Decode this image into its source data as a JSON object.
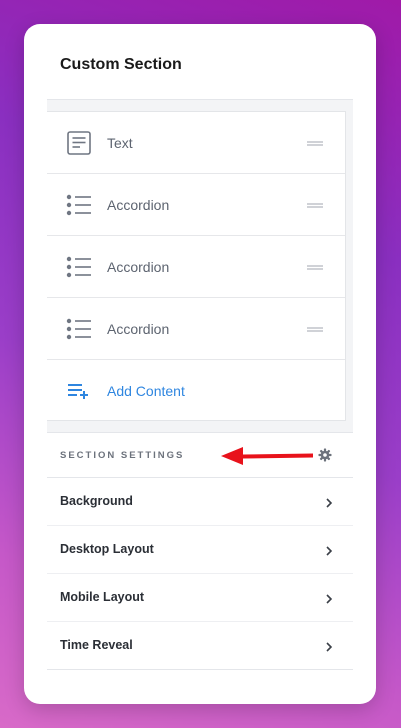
{
  "panel": {
    "title": "Custom Section"
  },
  "content_items": [
    {
      "icon": "text-icon",
      "label": "Text"
    },
    {
      "icon": "list-icon",
      "label": "Accordion"
    },
    {
      "icon": "list-icon",
      "label": "Accordion"
    },
    {
      "icon": "list-icon",
      "label": "Accordion"
    }
  ],
  "add_content": {
    "icon": "add-list-icon",
    "label": "Add Content"
  },
  "section_settings": {
    "title": "SECTION SETTINGS",
    "items": [
      {
        "label": "Background"
      },
      {
        "label": "Desktop Layout"
      },
      {
        "label": "Mobile Layout"
      },
      {
        "label": "Time Reveal"
      }
    ]
  },
  "colors": {
    "accent": "#2f86e0",
    "annotation_arrow": "#e8121b"
  }
}
